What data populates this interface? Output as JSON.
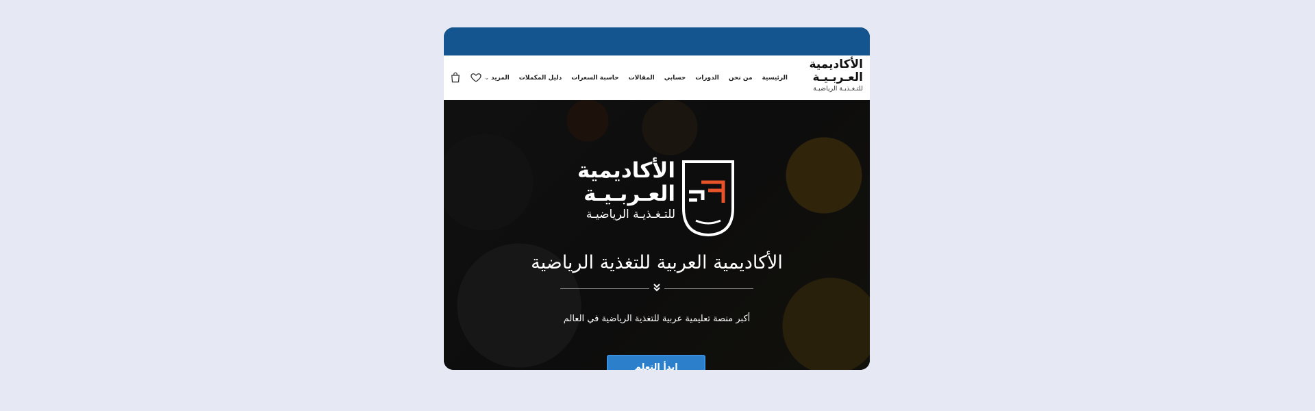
{
  "brand": {
    "line1": "الأكاديمية",
    "line2": "العـربـيـة",
    "line3": "للتـغـذيـة الرياضيـة"
  },
  "nav": {
    "items": [
      {
        "label": "الرئيسية"
      },
      {
        "label": "من نحن"
      },
      {
        "label": "الدورات"
      },
      {
        "label": "حسابي"
      },
      {
        "label": "المقالات"
      },
      {
        "label": "حاسبة السعرات"
      },
      {
        "label": "دليل المكملات"
      },
      {
        "label": "المزيد"
      }
    ],
    "icons": [
      "cart-icon",
      "heart-icon"
    ]
  },
  "hero": {
    "logo_line1": "الأكاديمية",
    "logo_line2": "العـربـيـة",
    "logo_line3": "للتـغـذيـة الرياضيـة",
    "title": "الأكاديمية العربية للتغذية الرياضية",
    "subtitle": "أكبر منصة تعليمية عربية للتغذية الرياضية في العالم",
    "cta_label": "ابدأ التعلم"
  },
  "colors": {
    "topbar": "#14558f",
    "accent": "#2b7fcb",
    "logo_mark": "#e8532a"
  }
}
